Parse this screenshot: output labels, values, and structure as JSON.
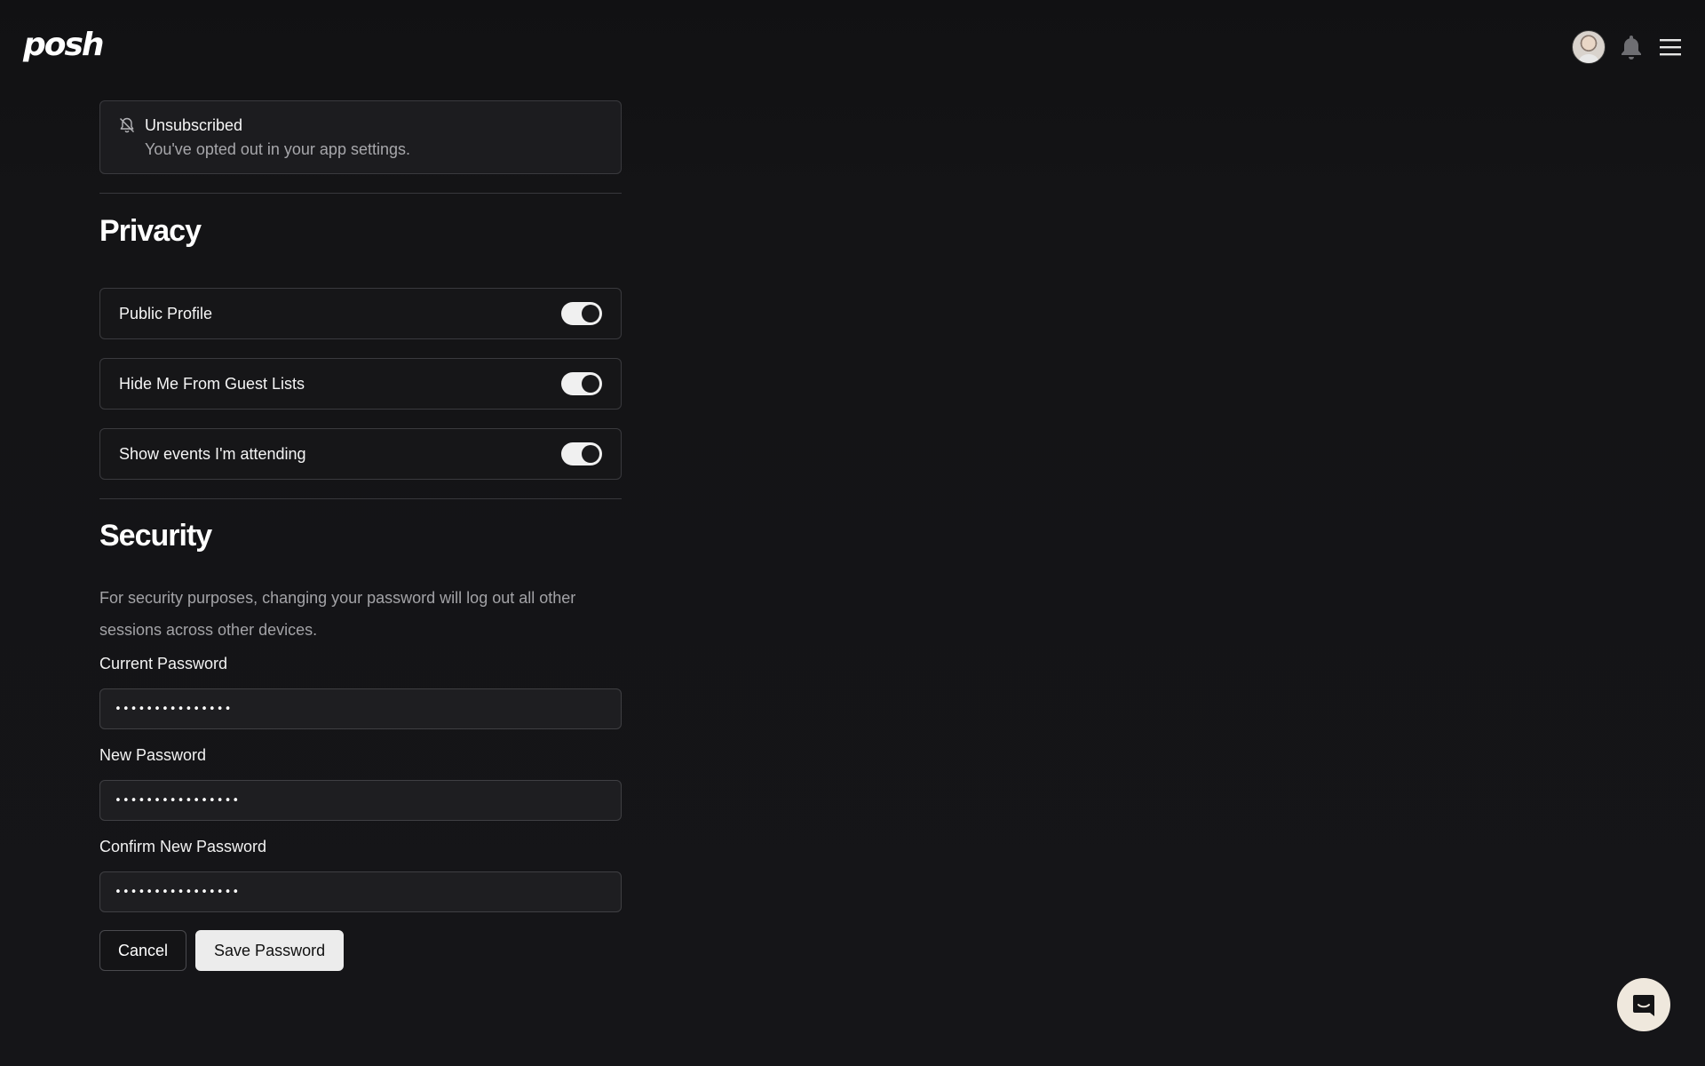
{
  "header": {
    "logo_text": "posh",
    "icons": [
      "avatar",
      "bell-icon",
      "hamburger-menu-icon"
    ]
  },
  "notice": {
    "icon": "bell-off-icon",
    "title": "Unsubscribed",
    "subtitle": "You've opted out in your app settings."
  },
  "privacy": {
    "heading": "Privacy",
    "toggles": [
      {
        "label": "Public Profile",
        "on": true
      },
      {
        "label": "Hide Me From Guest Lists",
        "on": true
      },
      {
        "label": "Show events I'm attending",
        "on": true
      }
    ]
  },
  "security": {
    "heading": "Security",
    "description": "For security purposes, changing your password will log out all other sessions across other devices.",
    "fields": [
      {
        "label": "Current Password",
        "value": "•••••••••••••••"
      },
      {
        "label": "New Password",
        "value": "••••••••••••••••"
      },
      {
        "label": "Confirm New Password",
        "value": "••••••••••••••••"
      }
    ],
    "cancel_label": "Cancel",
    "save_label": "Save Password"
  },
  "chat": {
    "icon": "chat-icon"
  },
  "colors": {
    "background": "#141416",
    "card_border": "#3a3a3e",
    "toggle_on": "#f0f0f0",
    "save_button_bg": "#ececec",
    "chat_button_bg": "#efe8dd"
  }
}
